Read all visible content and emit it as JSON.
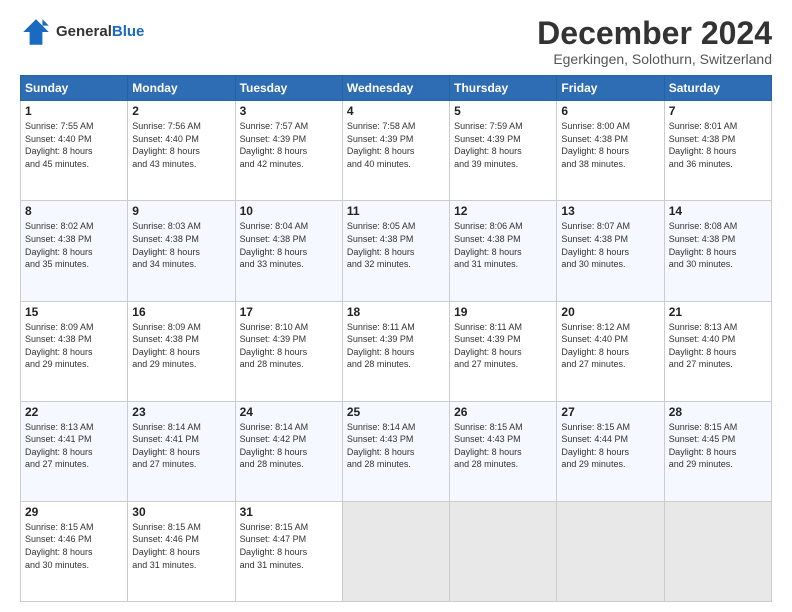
{
  "header": {
    "logo_line1": "General",
    "logo_line2": "Blue",
    "title": "December 2024",
    "subtitle": "Egerkingen, Solothurn, Switzerland"
  },
  "days_of_week": [
    "Sunday",
    "Monday",
    "Tuesday",
    "Wednesday",
    "Thursday",
    "Friday",
    "Saturday"
  ],
  "weeks": [
    [
      {
        "day": "1",
        "detail": "Sunrise: 7:55 AM\nSunset: 4:40 PM\nDaylight: 8 hours\nand 45 minutes."
      },
      {
        "day": "2",
        "detail": "Sunrise: 7:56 AM\nSunset: 4:40 PM\nDaylight: 8 hours\nand 43 minutes."
      },
      {
        "day": "3",
        "detail": "Sunrise: 7:57 AM\nSunset: 4:39 PM\nDaylight: 8 hours\nand 42 minutes."
      },
      {
        "day": "4",
        "detail": "Sunrise: 7:58 AM\nSunset: 4:39 PM\nDaylight: 8 hours\nand 40 minutes."
      },
      {
        "day": "5",
        "detail": "Sunrise: 7:59 AM\nSunset: 4:39 PM\nDaylight: 8 hours\nand 39 minutes."
      },
      {
        "day": "6",
        "detail": "Sunrise: 8:00 AM\nSunset: 4:38 PM\nDaylight: 8 hours\nand 38 minutes."
      },
      {
        "day": "7",
        "detail": "Sunrise: 8:01 AM\nSunset: 4:38 PM\nDaylight: 8 hours\nand 36 minutes."
      }
    ],
    [
      {
        "day": "8",
        "detail": "Sunrise: 8:02 AM\nSunset: 4:38 PM\nDaylight: 8 hours\nand 35 minutes."
      },
      {
        "day": "9",
        "detail": "Sunrise: 8:03 AM\nSunset: 4:38 PM\nDaylight: 8 hours\nand 34 minutes."
      },
      {
        "day": "10",
        "detail": "Sunrise: 8:04 AM\nSunset: 4:38 PM\nDaylight: 8 hours\nand 33 minutes."
      },
      {
        "day": "11",
        "detail": "Sunrise: 8:05 AM\nSunset: 4:38 PM\nDaylight: 8 hours\nand 32 minutes."
      },
      {
        "day": "12",
        "detail": "Sunrise: 8:06 AM\nSunset: 4:38 PM\nDaylight: 8 hours\nand 31 minutes."
      },
      {
        "day": "13",
        "detail": "Sunrise: 8:07 AM\nSunset: 4:38 PM\nDaylight: 8 hours\nand 30 minutes."
      },
      {
        "day": "14",
        "detail": "Sunrise: 8:08 AM\nSunset: 4:38 PM\nDaylight: 8 hours\nand 30 minutes."
      }
    ],
    [
      {
        "day": "15",
        "detail": "Sunrise: 8:09 AM\nSunset: 4:38 PM\nDaylight: 8 hours\nand 29 minutes."
      },
      {
        "day": "16",
        "detail": "Sunrise: 8:09 AM\nSunset: 4:38 PM\nDaylight: 8 hours\nand 29 minutes."
      },
      {
        "day": "17",
        "detail": "Sunrise: 8:10 AM\nSunset: 4:39 PM\nDaylight: 8 hours\nand 28 minutes."
      },
      {
        "day": "18",
        "detail": "Sunrise: 8:11 AM\nSunset: 4:39 PM\nDaylight: 8 hours\nand 28 minutes."
      },
      {
        "day": "19",
        "detail": "Sunrise: 8:11 AM\nSunset: 4:39 PM\nDaylight: 8 hours\nand 27 minutes."
      },
      {
        "day": "20",
        "detail": "Sunrise: 8:12 AM\nSunset: 4:40 PM\nDaylight: 8 hours\nand 27 minutes."
      },
      {
        "day": "21",
        "detail": "Sunrise: 8:13 AM\nSunset: 4:40 PM\nDaylight: 8 hours\nand 27 minutes."
      }
    ],
    [
      {
        "day": "22",
        "detail": "Sunrise: 8:13 AM\nSunset: 4:41 PM\nDaylight: 8 hours\nand 27 minutes."
      },
      {
        "day": "23",
        "detail": "Sunrise: 8:14 AM\nSunset: 4:41 PM\nDaylight: 8 hours\nand 27 minutes."
      },
      {
        "day": "24",
        "detail": "Sunrise: 8:14 AM\nSunset: 4:42 PM\nDaylight: 8 hours\nand 28 minutes."
      },
      {
        "day": "25",
        "detail": "Sunrise: 8:14 AM\nSunset: 4:43 PM\nDaylight: 8 hours\nand 28 minutes."
      },
      {
        "day": "26",
        "detail": "Sunrise: 8:15 AM\nSunset: 4:43 PM\nDaylight: 8 hours\nand 28 minutes."
      },
      {
        "day": "27",
        "detail": "Sunrise: 8:15 AM\nSunset: 4:44 PM\nDaylight: 8 hours\nand 29 minutes."
      },
      {
        "day": "28",
        "detail": "Sunrise: 8:15 AM\nSunset: 4:45 PM\nDaylight: 8 hours\nand 29 minutes."
      }
    ],
    [
      {
        "day": "29",
        "detail": "Sunrise: 8:15 AM\nSunset: 4:46 PM\nDaylight: 8 hours\nand 30 minutes."
      },
      {
        "day": "30",
        "detail": "Sunrise: 8:15 AM\nSunset: 4:46 PM\nDaylight: 8 hours\nand 31 minutes."
      },
      {
        "day": "31",
        "detail": "Sunrise: 8:15 AM\nSunset: 4:47 PM\nDaylight: 8 hours\nand 31 minutes."
      },
      {
        "day": "",
        "detail": ""
      },
      {
        "day": "",
        "detail": ""
      },
      {
        "day": "",
        "detail": ""
      },
      {
        "day": "",
        "detail": ""
      }
    ]
  ]
}
